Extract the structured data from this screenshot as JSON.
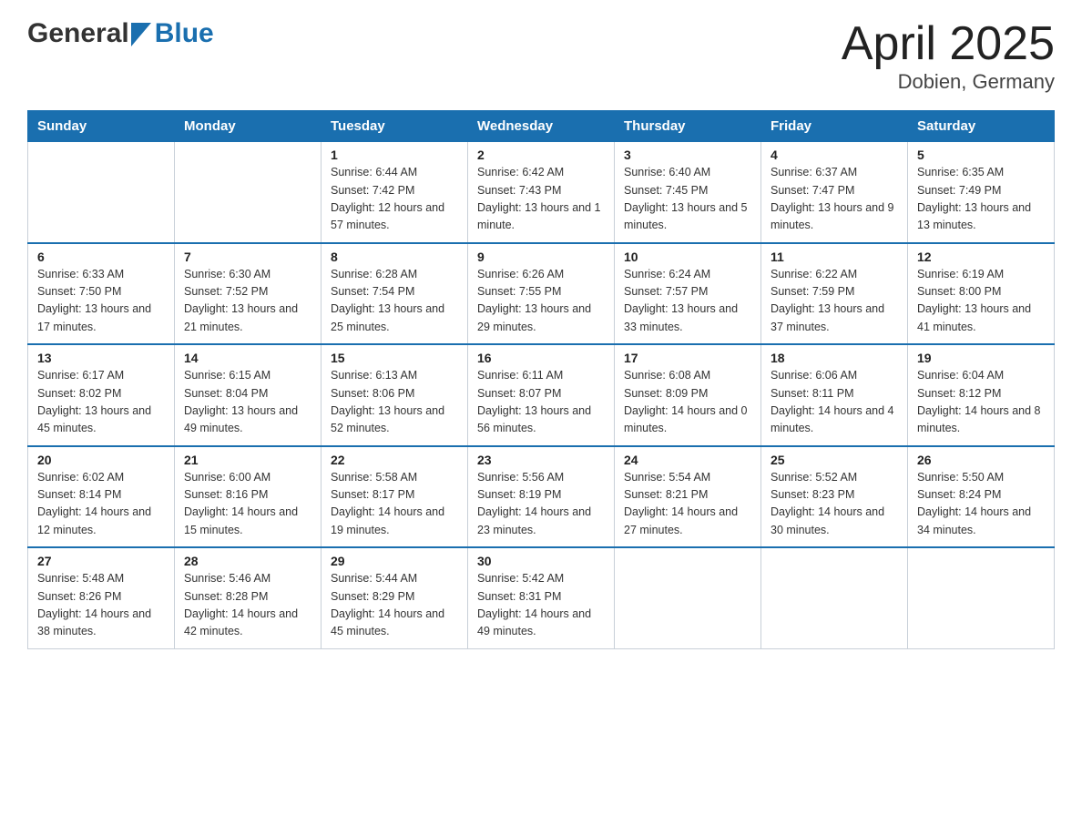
{
  "header": {
    "logo": {
      "general_text": "General",
      "blue_text": "Blue"
    },
    "title": "April 2025",
    "location": "Dobien, Germany"
  },
  "weekdays": [
    "Sunday",
    "Monday",
    "Tuesday",
    "Wednesday",
    "Thursday",
    "Friday",
    "Saturday"
  ],
  "weeks": [
    [
      {
        "day": "",
        "sunrise": "",
        "sunset": "",
        "daylight": ""
      },
      {
        "day": "",
        "sunrise": "",
        "sunset": "",
        "daylight": ""
      },
      {
        "day": "1",
        "sunrise": "Sunrise: 6:44 AM",
        "sunset": "Sunset: 7:42 PM",
        "daylight": "Daylight: 12 hours and 57 minutes."
      },
      {
        "day": "2",
        "sunrise": "Sunrise: 6:42 AM",
        "sunset": "Sunset: 7:43 PM",
        "daylight": "Daylight: 13 hours and 1 minute."
      },
      {
        "day": "3",
        "sunrise": "Sunrise: 6:40 AM",
        "sunset": "Sunset: 7:45 PM",
        "daylight": "Daylight: 13 hours and 5 minutes."
      },
      {
        "day": "4",
        "sunrise": "Sunrise: 6:37 AM",
        "sunset": "Sunset: 7:47 PM",
        "daylight": "Daylight: 13 hours and 9 minutes."
      },
      {
        "day": "5",
        "sunrise": "Sunrise: 6:35 AM",
        "sunset": "Sunset: 7:49 PM",
        "daylight": "Daylight: 13 hours and 13 minutes."
      }
    ],
    [
      {
        "day": "6",
        "sunrise": "Sunrise: 6:33 AM",
        "sunset": "Sunset: 7:50 PM",
        "daylight": "Daylight: 13 hours and 17 minutes."
      },
      {
        "day": "7",
        "sunrise": "Sunrise: 6:30 AM",
        "sunset": "Sunset: 7:52 PM",
        "daylight": "Daylight: 13 hours and 21 minutes."
      },
      {
        "day": "8",
        "sunrise": "Sunrise: 6:28 AM",
        "sunset": "Sunset: 7:54 PM",
        "daylight": "Daylight: 13 hours and 25 minutes."
      },
      {
        "day": "9",
        "sunrise": "Sunrise: 6:26 AM",
        "sunset": "Sunset: 7:55 PM",
        "daylight": "Daylight: 13 hours and 29 minutes."
      },
      {
        "day": "10",
        "sunrise": "Sunrise: 6:24 AM",
        "sunset": "Sunset: 7:57 PM",
        "daylight": "Daylight: 13 hours and 33 minutes."
      },
      {
        "day": "11",
        "sunrise": "Sunrise: 6:22 AM",
        "sunset": "Sunset: 7:59 PM",
        "daylight": "Daylight: 13 hours and 37 minutes."
      },
      {
        "day": "12",
        "sunrise": "Sunrise: 6:19 AM",
        "sunset": "Sunset: 8:00 PM",
        "daylight": "Daylight: 13 hours and 41 minutes."
      }
    ],
    [
      {
        "day": "13",
        "sunrise": "Sunrise: 6:17 AM",
        "sunset": "Sunset: 8:02 PM",
        "daylight": "Daylight: 13 hours and 45 minutes."
      },
      {
        "day": "14",
        "sunrise": "Sunrise: 6:15 AM",
        "sunset": "Sunset: 8:04 PM",
        "daylight": "Daylight: 13 hours and 49 minutes."
      },
      {
        "day": "15",
        "sunrise": "Sunrise: 6:13 AM",
        "sunset": "Sunset: 8:06 PM",
        "daylight": "Daylight: 13 hours and 52 minutes."
      },
      {
        "day": "16",
        "sunrise": "Sunrise: 6:11 AM",
        "sunset": "Sunset: 8:07 PM",
        "daylight": "Daylight: 13 hours and 56 minutes."
      },
      {
        "day": "17",
        "sunrise": "Sunrise: 6:08 AM",
        "sunset": "Sunset: 8:09 PM",
        "daylight": "Daylight: 14 hours and 0 minutes."
      },
      {
        "day": "18",
        "sunrise": "Sunrise: 6:06 AM",
        "sunset": "Sunset: 8:11 PM",
        "daylight": "Daylight: 14 hours and 4 minutes."
      },
      {
        "day": "19",
        "sunrise": "Sunrise: 6:04 AM",
        "sunset": "Sunset: 8:12 PM",
        "daylight": "Daylight: 14 hours and 8 minutes."
      }
    ],
    [
      {
        "day": "20",
        "sunrise": "Sunrise: 6:02 AM",
        "sunset": "Sunset: 8:14 PM",
        "daylight": "Daylight: 14 hours and 12 minutes."
      },
      {
        "day": "21",
        "sunrise": "Sunrise: 6:00 AM",
        "sunset": "Sunset: 8:16 PM",
        "daylight": "Daylight: 14 hours and 15 minutes."
      },
      {
        "day": "22",
        "sunrise": "Sunrise: 5:58 AM",
        "sunset": "Sunset: 8:17 PM",
        "daylight": "Daylight: 14 hours and 19 minutes."
      },
      {
        "day": "23",
        "sunrise": "Sunrise: 5:56 AM",
        "sunset": "Sunset: 8:19 PM",
        "daylight": "Daylight: 14 hours and 23 minutes."
      },
      {
        "day": "24",
        "sunrise": "Sunrise: 5:54 AM",
        "sunset": "Sunset: 8:21 PM",
        "daylight": "Daylight: 14 hours and 27 minutes."
      },
      {
        "day": "25",
        "sunrise": "Sunrise: 5:52 AM",
        "sunset": "Sunset: 8:23 PM",
        "daylight": "Daylight: 14 hours and 30 minutes."
      },
      {
        "day": "26",
        "sunrise": "Sunrise: 5:50 AM",
        "sunset": "Sunset: 8:24 PM",
        "daylight": "Daylight: 14 hours and 34 minutes."
      }
    ],
    [
      {
        "day": "27",
        "sunrise": "Sunrise: 5:48 AM",
        "sunset": "Sunset: 8:26 PM",
        "daylight": "Daylight: 14 hours and 38 minutes."
      },
      {
        "day": "28",
        "sunrise": "Sunrise: 5:46 AM",
        "sunset": "Sunset: 8:28 PM",
        "daylight": "Daylight: 14 hours and 42 minutes."
      },
      {
        "day": "29",
        "sunrise": "Sunrise: 5:44 AM",
        "sunset": "Sunset: 8:29 PM",
        "daylight": "Daylight: 14 hours and 45 minutes."
      },
      {
        "day": "30",
        "sunrise": "Sunrise: 5:42 AM",
        "sunset": "Sunset: 8:31 PM",
        "daylight": "Daylight: 14 hours and 49 minutes."
      },
      {
        "day": "",
        "sunrise": "",
        "sunset": "",
        "daylight": ""
      },
      {
        "day": "",
        "sunrise": "",
        "sunset": "",
        "daylight": ""
      },
      {
        "day": "",
        "sunrise": "",
        "sunset": "",
        "daylight": ""
      }
    ]
  ]
}
